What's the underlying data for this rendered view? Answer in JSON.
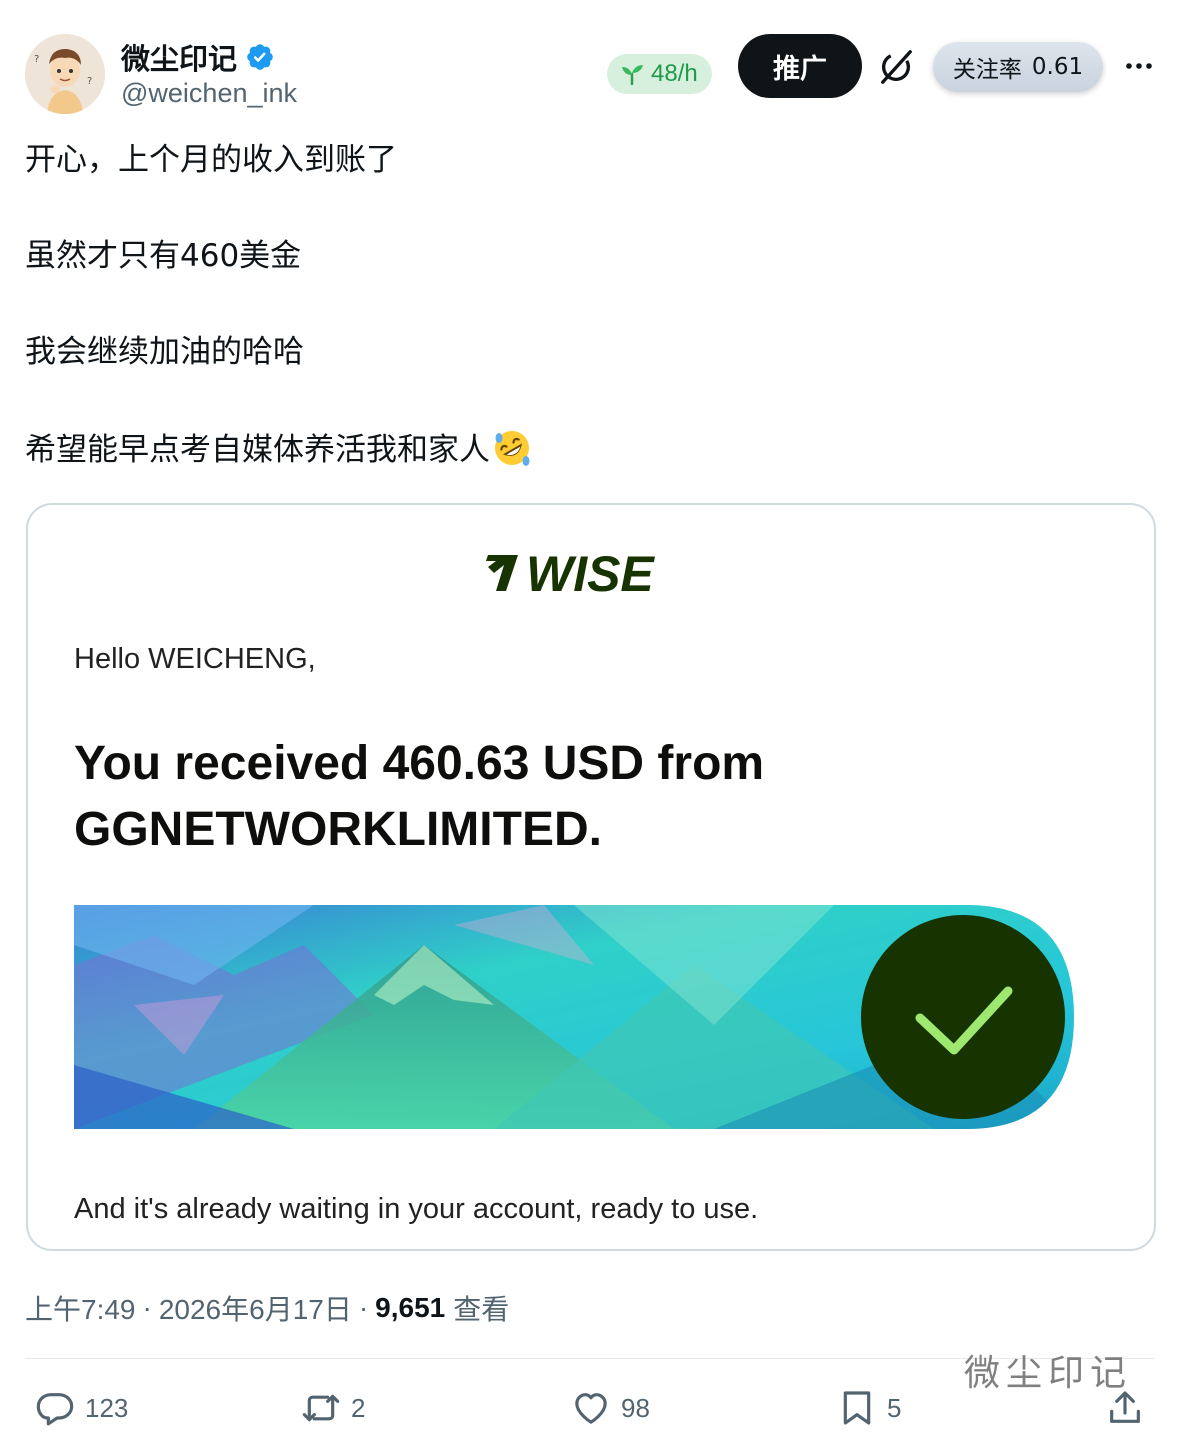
{
  "author": {
    "display_name": "微尘印记",
    "handle": "@weichen_ink",
    "verified": true,
    "avatar_icon": "cartoon-boy-avatar"
  },
  "header": {
    "rate_badge": "48/h",
    "promote_label": "推广",
    "follow_rate_label": "关注率",
    "follow_rate_value": "0.61"
  },
  "tweet": {
    "lines": [
      "开心，上个月的收入到账了",
      "虽然才只有460美金",
      "我会继续加油的哈哈",
      "希望能早点考自媒体养活我和家人"
    ],
    "emoji": "rolling-on-floor-laughing"
  },
  "media": {
    "brand": "WISE",
    "greeting": "Hello WEICHENG,",
    "headline_line1": "You received 460.63 USD from",
    "headline_line2": "GGNETWORKLIMITED.",
    "footer": "And it's already waiting in your account, ready to use.",
    "colors": {
      "brand_green": "#163300",
      "check_green": "#9fe870"
    }
  },
  "meta": {
    "time": "上午7:49",
    "date": "2026年6月17日",
    "separator": "·",
    "views_count": "9,651",
    "views_label": "查看"
  },
  "actions": {
    "replies": "123",
    "retweets": "2",
    "likes": "98",
    "bookmarks": "5"
  },
  "watermark": "微尘印记",
  "colors": {
    "verified_blue": "#1d9bf0",
    "text_secondary": "#536471",
    "promote_bg": "#0f1419"
  }
}
